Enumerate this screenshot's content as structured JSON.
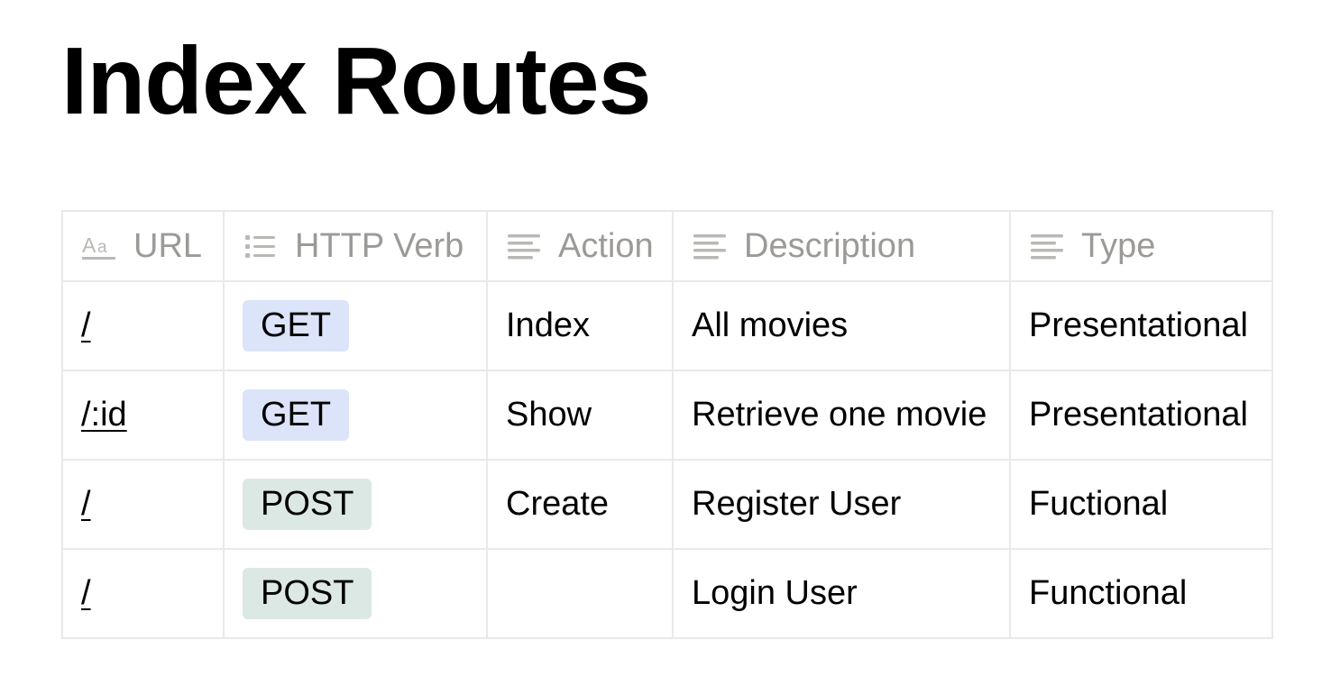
{
  "page": {
    "title": "Index Routes"
  },
  "columns": [
    {
      "label": "URL",
      "icon": "title-property-icon"
    },
    {
      "label": "HTTP Verb",
      "icon": "list-property-icon"
    },
    {
      "label": "Action",
      "icon": "text-property-icon"
    },
    {
      "label": "Description",
      "icon": "text-property-icon"
    },
    {
      "label": "Type",
      "icon": "text-property-icon"
    }
  ],
  "tag_colors": {
    "GET": "#dbe4f8",
    "POST": "#dce8e3"
  },
  "rows": [
    {
      "url": "/",
      "verb": "GET",
      "action": "Index",
      "description": "All movies",
      "type": "Presentational"
    },
    {
      "url": "/:id",
      "verb": "GET",
      "action": "Show",
      "description": "Retrieve one movie",
      "type": "Presentational"
    },
    {
      "url": "/",
      "verb": "POST",
      "action": "Create",
      "description": "Register User",
      "type": "Fuctional"
    },
    {
      "url": "/",
      "verb": "POST",
      "action": "",
      "description": "Login User",
      "type": "Functional"
    }
  ]
}
